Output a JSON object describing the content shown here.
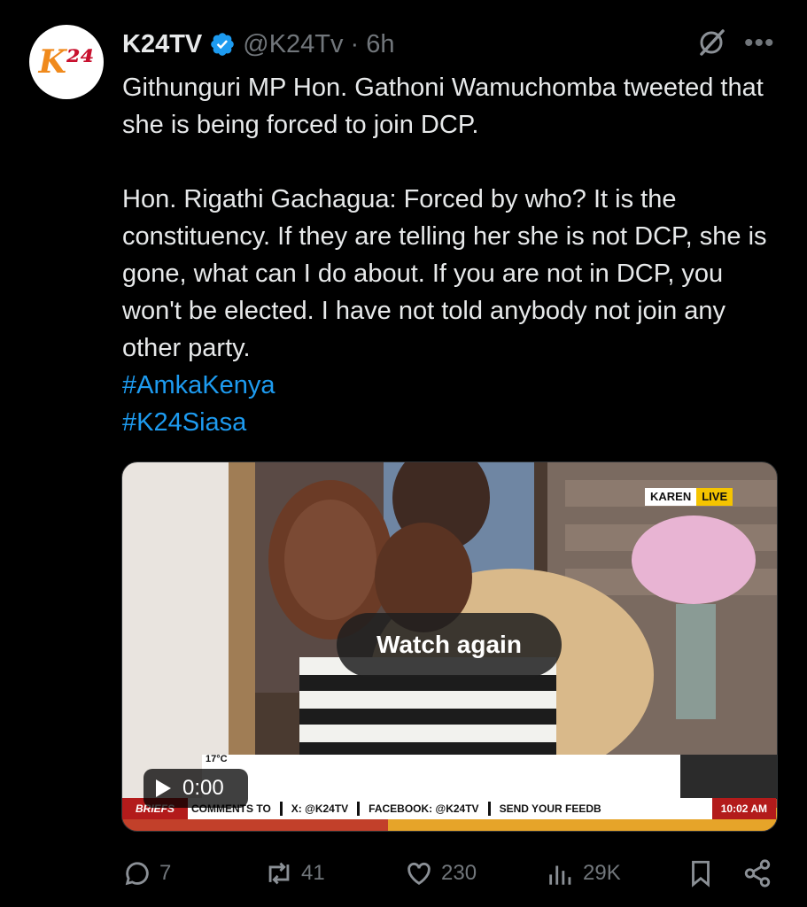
{
  "tweet": {
    "display_name": "K24TV",
    "handle": "@K24Tv",
    "separator": "·",
    "time": "6h",
    "text": "Githunguri MP Hon. Gathoni Wamuchomba tweeted that she is being forced to join DCP.\n\nHon. Rigathi Gachagua: Forced by who? It is the constituency. If they are telling her she is not DCP, she is gone, what can I do about. If you are not in DCP, you won't be elected. I have not told anybody not join any other party.",
    "hashtags": [
      "#AmkaKenya",
      "#K24Siasa"
    ]
  },
  "video": {
    "watch_again_label": "Watch again",
    "time": "0:00",
    "overlay": {
      "location": "KAREN",
      "live": "LIVE",
      "temperature": "17°C",
      "ticker_label": "BRIEFS",
      "ticker_items": [
        "COMMENTS TO",
        "X: @K24TV",
        "FACEBOOK: @K24TV",
        "SEND YOUR FEEDB"
      ],
      "clock": "10:02 AM"
    }
  },
  "actions": {
    "replies": "7",
    "reposts": "41",
    "likes": "230",
    "views": "29K"
  },
  "colors": {
    "background": "#000000",
    "text": "#e7e9ea",
    "muted": "#71767b",
    "link": "#1d9bf0",
    "verified": "#1d9bf0"
  }
}
